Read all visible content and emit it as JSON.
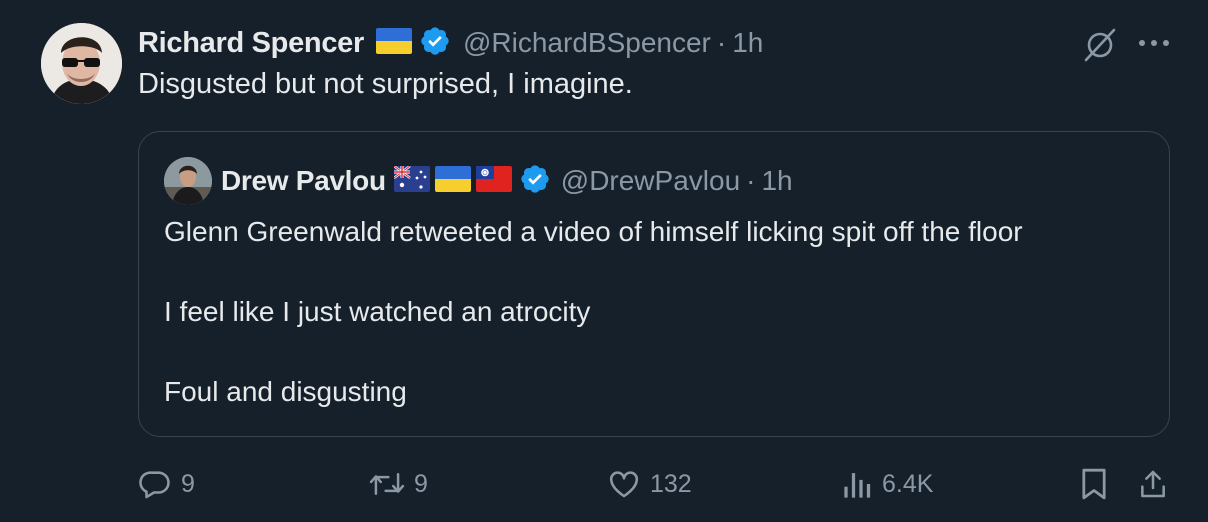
{
  "author": {
    "name": "Richard Spencer",
    "handle": "@RichardBSpencer",
    "time": "1h"
  },
  "post_text": "Disgusted but not surprised, I imagine.",
  "quoted": {
    "name": "Drew Pavlou",
    "handle": "@DrewPavlou",
    "time": "1h",
    "lines": [
      "Glenn Greenwald retweeted a video of himself licking spit off the floor",
      "I feel like I just watched an atrocity",
      "Foul and disgusting"
    ]
  },
  "actions": {
    "replies": "9",
    "reposts": "9",
    "likes": "132",
    "views": "6.4K"
  },
  "separator": "·",
  "colors": {
    "background": "#15202b",
    "text_primary": "#e7e9ea",
    "text_secondary": "#8b98a5",
    "verified": "#1d9bf0",
    "border": "#38444d"
  },
  "icons": [
    "grok-icon",
    "more-icon",
    "verified-badge-icon",
    "ukraine-flag-icon",
    "australia-flag-icon",
    "taiwan-flag-icon",
    "reply-icon",
    "repost-icon",
    "like-icon",
    "views-icon",
    "bookmark-icon",
    "share-icon"
  ]
}
